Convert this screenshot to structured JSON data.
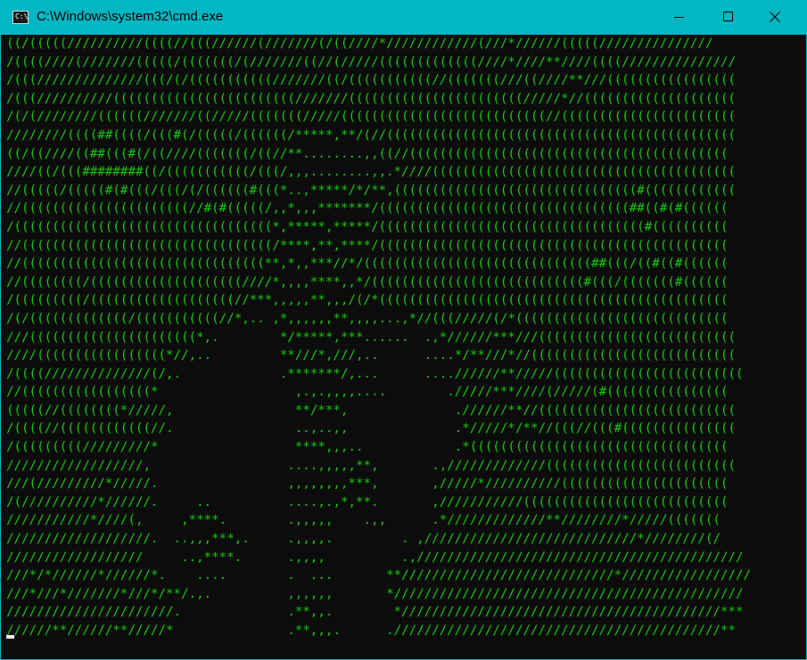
{
  "window": {
    "title": "C:\\Windows\\system32\\cmd.exe",
    "icon": "cmd-app-icon",
    "icon_glyph": "C:\\",
    "controls": {
      "minimize_icon": "minimize-icon",
      "maximize_icon": "maximize-icon",
      "close_icon": "close-icon"
    }
  },
  "colors": {
    "titlebar": "#00b7c3",
    "console_background": "#0c0c0c",
    "console_text": "#16c60c",
    "cursor": "#f2f2f2"
  },
  "console": {
    "lines": [
      "((/(((((//////////((((//(((//////(///////(/((////*////////////(///*//////(((((///////////////",
      "/((((////(///////(((((/(((((((/(///////((//(/////(((((((((((((////*////**////((((///////////////",
      "/(((//////////////(((/(/(((((((((((///////((/(((((((((((//(((((((///((////**///(((((((((((((((((",
      "/(((//////////((((((((((((((((((((((((///////(((((((((((((((((((((((/////*//((((((((((((((((((((",
      "/(/(////////((((((///////((/////(((((((/////(((((((((((((((((((((((((((//(((((((((((((((((((((((",
      "////////((((##((((/(((#(/(((((/((((((/*****,**/(//((((((((((((((((((((((((((((((((((((((((((((((",
      "((/((////((##(((#(/((////(((((((/((//**........,,((//((((((((((((((((((((((((((((((((((((((((((",
      "////((/(((########((/(((((((((((/(((/,,,........,,.*////((((((((((((((((((((((((((((((((((((((((",
      "//(((((/(((((#(#(((/(((/(/((((((#(((*..,*****/*/**,((((((((((((((((((((((((((((((((#((((((((((((",
      "//((((((((((((((((((((((//#(#(((((/,,*,,,*******/(((((((((((((((((((((((((((((((((##((#(#((((((",
      "/((((((((((((((((((((((((((((((((((*,*****,*****/(((((((((((((((((((((((((((((((((((#((((((((((",
      "//(((((((((((((((((((((((((((((((((/****,**,****/((((((((((((((((((((((((((((((((((((((((((((((",
      "//((((((((((((((((((((((((((((((((**,*,,***//*/((((((((((((((((((((((((((((((##(((/((#((#((((((",
      "//((((((((/((((((((((((((((((((////*,,,,****,,*/((((((((((((((((((((((((((((#(((/(((((((#((((((",
      "/(((((((((/(((((((((((((((((((//***,,,,,**,,,/(/*((((((((((((((((((((((((((((((((((((((((((((((",
      "/(/(((((((((((((/(((((((((((//*,.. ,*,,,,,,**,,,,...,*//(((/////(/*((((((((((((((((((((((((((((",
      "///((((((((((((((((((((((*,.        */*****,***......  .,*//////***///((((((((((((((((((((((((((",
      "////(((((((((((((((((*//,..         **///*,///,..      ....*/**///*//(((((((((((((((((((((((((((",
      "/((((//////////////(/,.             .*******/,...      ....//////**/////(((((((((((((((((((((((((",
      "//(((((((((((((((((*                  ,.,.,,,,....        ./////***////(/////(#((((((((((((((((",
      "(((((//((((((((*/////,                **/***,              .//////**//((((((((((((((((((((((((((",
      "/((((//((((((((((((//.                ..,..,,              .*/////*/**//(((//(((#(((((((((((((((",
      "/(((((((((/////////*                  ****,,,..            .*((((((((((((((((((((((((((((((((((",
      "//////////////////,                  ....,,,,,**,       .,/////////////(((((((((((((((((((((((((",
      "///(/////////*/////.                 ,,,,,,,,***,       ,/////*//////////((((((((((((((((((((((",
      "/(//////////*//////.     ..          ....,.,*,**.       ,///////////(((((((((((((((((((((((((((",
      "///////////*////(,     ,****.        .,,,,,    .,,      .*/////////////**////////*/////(((((((",
      "///////////////////.  ..,,,***,.     .,,,,.         . ,////////////////////////////*////////(/",
      "//////////////////     ..,****.      .,,,,          .,///////////////////////////////////////////",
      "///*/*//////*//////*.    ....        .  ...       **////////////////////////////*/////////////////",
      "///*///*///////*///*/**/.,.          ,,,,,,       *//////////////////////////////////////////////",
      "//////////////////////.              .**,,.        *//////////////////////////////////////////***",
      "//////**//////**/////*               .**,,,.      .///////////////////////////////////////////**"
    ]
  }
}
